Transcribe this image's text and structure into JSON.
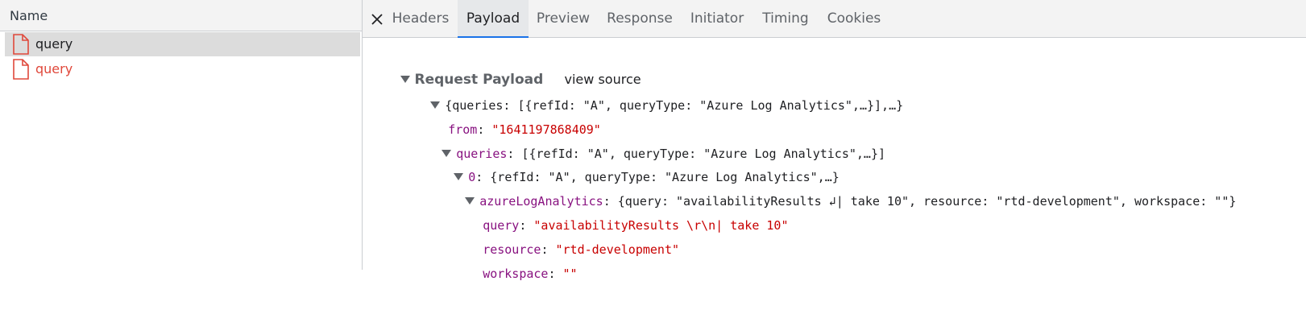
{
  "left": {
    "column_header": "Name",
    "requests": [
      {
        "label": "query",
        "state": "selected"
      },
      {
        "label": "query",
        "state": "error"
      }
    ]
  },
  "tabs": [
    "Headers",
    "Payload",
    "Preview",
    "Response",
    "Initiator",
    "Timing",
    "Cookies"
  ],
  "active_tab": "Payload",
  "payload": {
    "section_title": "Request Payload",
    "view_source": "view source",
    "root_summary": "{queries: [{refId: \"A\", queryType: \"Azure Log Analytics\",…}],…}",
    "from_key": "from",
    "from_value": "\"1641197868409\"",
    "queries_key": "queries",
    "queries_summary": "[{refId: \"A\", queryType: \"Azure Log Analytics\",…}]",
    "item_key": "0",
    "item_summary": "{refId: \"A\", queryType: \"Azure Log Analytics\",…}",
    "ala_key": "azureLogAnalytics",
    "ala_summary": "{query: \"availabilityResults ↲| take 10\", resource: \"rtd-development\", workspace: \"\"}",
    "query_key": "query",
    "query_value": "\"availabilityResults \\r\\n| take 10\"",
    "resource_key": "resource",
    "resource_value": "\"rtd-development\"",
    "workspace_key": "workspace",
    "workspace_value": "\"\""
  },
  "colors": {
    "key": "#881280",
    "string": "#c80000",
    "error": "#e0483b",
    "tab_accent": "#1a73e8"
  },
  "icons": [
    "file-icon",
    "close-icon",
    "expand-triangle-icon"
  ]
}
